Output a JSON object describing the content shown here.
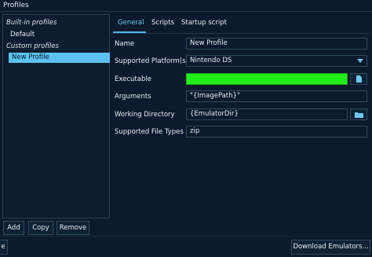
{
  "window": {
    "title": "Profiles"
  },
  "profiles": {
    "builtin_label": "Built-in profiles",
    "builtin_items": [
      "Default"
    ],
    "custom_label": "Custom profiles",
    "custom_items": [
      "New Profile"
    ],
    "selected": "New Profile"
  },
  "actions": {
    "add": "Add",
    "copy": "Copy",
    "remove": "Remove",
    "left_partial": "e",
    "download": "Download Emulators..."
  },
  "tabs": [
    {
      "label": "General",
      "active": true
    },
    {
      "label": "Scripts",
      "active": false
    },
    {
      "label": "Startup script",
      "active": false
    }
  ],
  "form": {
    "name_label": "Name",
    "name_value": "New Profile",
    "platform_label": "Supported Platform(s)",
    "platform_value": "Nintendo DS",
    "executable_label": "Executable",
    "executable_value": "",
    "arguments_label": "Arguments",
    "arguments_value": "\"{ImagePath}\"",
    "workdir_label": "Working Directory",
    "workdir_value": "{EmulatorDir}",
    "filetypes_label": "Supported File Types",
    "filetypes_value": "zip"
  },
  "colors": {
    "accent": "#5cc2ef",
    "executable_fill": "#22ef1a",
    "background": "#0b1a2c"
  },
  "icons": {
    "file_browse": "file-icon",
    "folder_browse": "folder-icon",
    "dropdown": "chevron-down-icon"
  }
}
